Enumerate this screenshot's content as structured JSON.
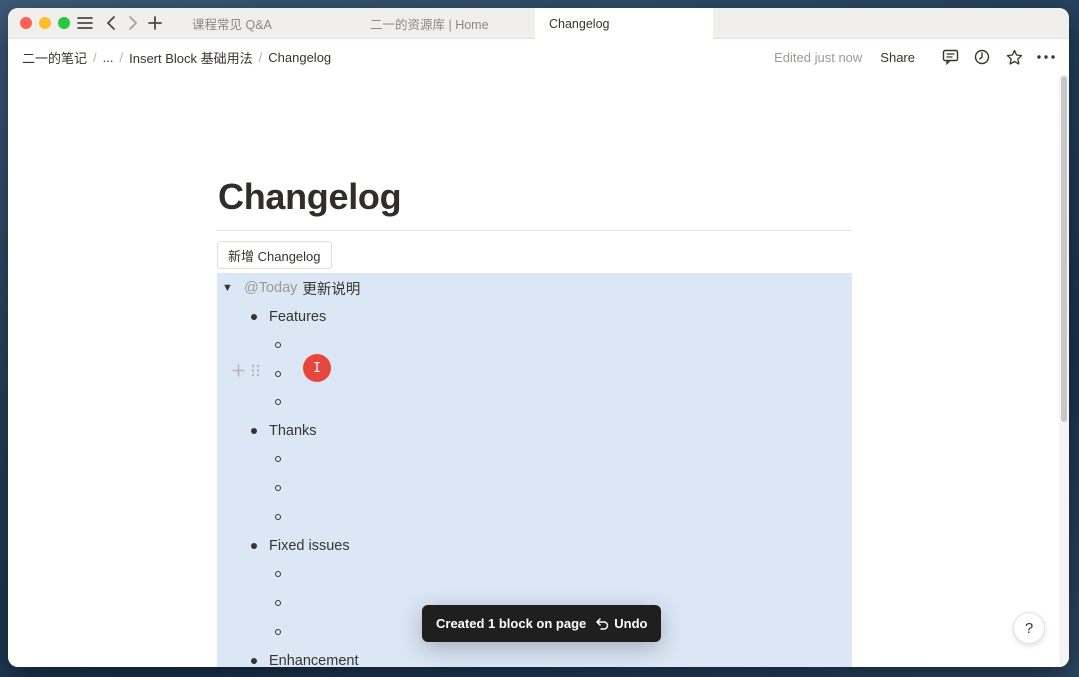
{
  "tabs": [
    {
      "label": "课程常见 Q&A"
    },
    {
      "label": "二一的资源库 | Home"
    },
    {
      "label": "Changelog"
    }
  ],
  "breadcrumbs": [
    "二一的笔记",
    "...",
    "Insert Block 基础用法",
    "Changelog"
  ],
  "breadcrumb_separator": "/",
  "topbar": {
    "edited": "Edited just now",
    "share": "Share"
  },
  "page": {
    "title": "Changelog",
    "button": "新增 Changelog",
    "toggle_mention": "@Today",
    "toggle_text": "更新说明",
    "sections": [
      "Features",
      "Thanks",
      "Fixed issues",
      "Enhancement"
    ]
  },
  "toast": {
    "message": "Created 1 block on page",
    "undo": "Undo"
  },
  "help": "?",
  "colors": {
    "selection": "#dce7f6",
    "accent_cursor": "#e8453c"
  }
}
